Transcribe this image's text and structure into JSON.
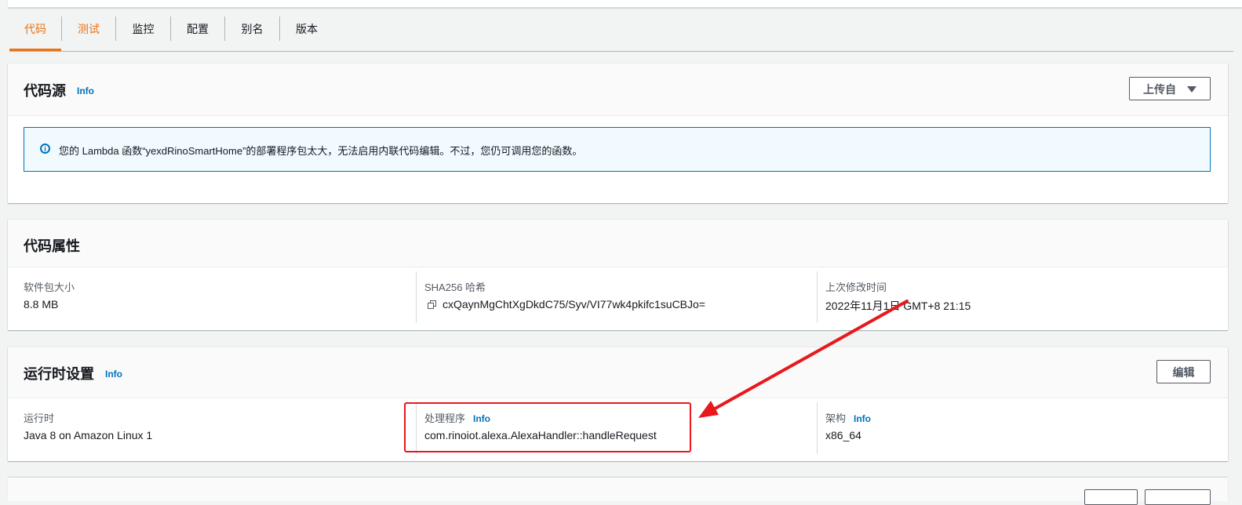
{
  "tabs": [
    {
      "label": "代码"
    },
    {
      "label": "测试"
    },
    {
      "label": "监控"
    },
    {
      "label": "配置"
    },
    {
      "label": "别名"
    },
    {
      "label": "版本"
    }
  ],
  "code_source": {
    "title": "代码源",
    "info": "Info",
    "upload_button": "上传自",
    "alert_text": "您的 Lambda 函数“yexdRinoSmartHome”的部署程序包太大，无法启用内联代码编辑。不过，您仍可调用您的函数。"
  },
  "code_properties": {
    "title": "代码属性",
    "package_size_label": "软件包大小",
    "package_size_value": "8.8 MB",
    "sha_label": "SHA256 哈希",
    "sha_value": "cxQaynMgChtXgDkdC75/Syv/VI77wk4pkifc1suCBJo=",
    "modified_label": "上次修改时间",
    "modified_value": "2022年11月1日 GMT+8 21:15"
  },
  "runtime_settings": {
    "title": "运行时设置",
    "info": "Info",
    "edit_button": "编辑",
    "runtime_label": "运行时",
    "runtime_value": "Java 8 on Amazon Linux 1",
    "handler_label": "处理程序",
    "handler_info": "Info",
    "handler_value": "com.rinoiot.alexa.AlexaHandler::handleRequest",
    "arch_label": "架构",
    "arch_info": "Info",
    "arch_value": "x86_64"
  },
  "colors": {
    "accent": "#ec7211",
    "link": "#0073bb",
    "annotation": "#e8181c"
  }
}
